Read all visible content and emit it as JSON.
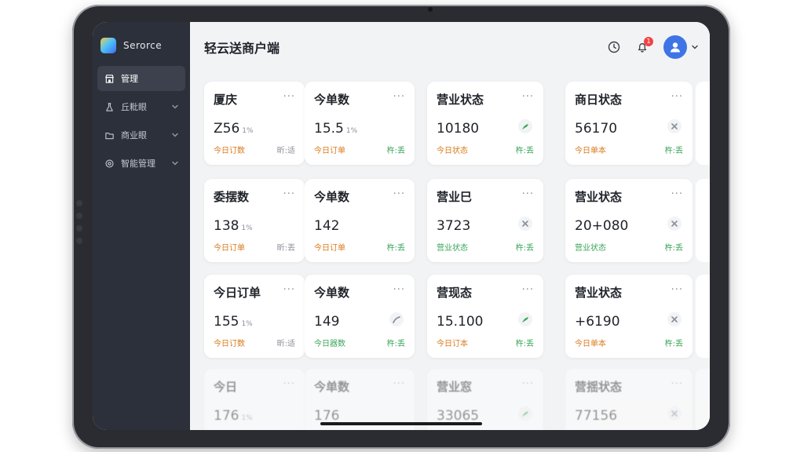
{
  "brand": {
    "name": "Serorce"
  },
  "sidebar": {
    "items": [
      {
        "label": "管理",
        "icon": "store-icon",
        "active": true,
        "chevron": false
      },
      {
        "label": "丘粃眼",
        "icon": "flask-icon",
        "active": false,
        "chevron": true
      },
      {
        "label": "商业眼",
        "icon": "folder-icon",
        "active": false,
        "chevron": true
      },
      {
        "label": "智能管理",
        "icon": "settings-icon",
        "active": false,
        "chevron": true
      }
    ]
  },
  "header": {
    "title": "轻云送商户端",
    "notification_count": "1"
  },
  "colors": {
    "accent": "#3f74e6",
    "sidebar": "#2c303a",
    "orange": "#d97a1a",
    "green": "#3aa55a"
  },
  "cards": [
    {
      "title": "厦庆",
      "value": "Z56",
      "unit": "1%",
      "foot_left": "今日订数",
      "foot_right": "昕:适",
      "trend": "none"
    },
    {
      "title": "今单数",
      "value": "15.5",
      "unit": "1%",
      "foot_left": "今日订单",
      "foot_right": "杵:丢",
      "trend": "none"
    },
    {
      "title": "营业状态",
      "value": "10180",
      "unit": "",
      "foot_left": "今日状态",
      "foot_right": "杵:丢",
      "trend": "up-green"
    },
    {
      "title": "商日状态",
      "value": "56170",
      "unit": "",
      "foot_left": "今日单本",
      "foot_right": "杵:丢",
      "trend": "cross"
    },
    {
      "title": "委摆数",
      "value": "138",
      "unit": "1%",
      "foot_left": "今日订单",
      "foot_right": "昕:丟",
      "trend": "none"
    },
    {
      "title": "今单数",
      "value": "142",
      "unit": "",
      "foot_left": "今日订单",
      "foot_right": "杵:丢",
      "trend": "none"
    },
    {
      "title": "营业巳",
      "value": "3723",
      "unit": "",
      "foot_left": "营业状态",
      "foot_right": "杵:丢",
      "trend": "cross"
    },
    {
      "title": "营业状态",
      "value": "20+080",
      "unit": "",
      "foot_left": "营业状态",
      "foot_right": "杵:丢",
      "trend": "cross"
    },
    {
      "title": "今日订单",
      "value": "155",
      "unit": "1%",
      "foot_left": "今日订数",
      "foot_right": "昕:适",
      "trend": "none"
    },
    {
      "title": "今单数",
      "value": "149",
      "unit": "",
      "foot_left": "今日器数",
      "foot_right": "杵:丢",
      "trend": "up-gray"
    },
    {
      "title": "营现态",
      "value": "15.100",
      "unit": "",
      "foot_left": "今日订本",
      "foot_right": "杵:丢",
      "trend": "up-green"
    },
    {
      "title": "营业状态",
      "value": "+6190",
      "unit": "",
      "foot_left": "今日单本",
      "foot_right": "杵:丢",
      "trend": "cross"
    },
    {
      "title": "今日",
      "value": "176",
      "unit": "1%",
      "foot_left": "",
      "foot_right": "",
      "trend": "none",
      "faded": true
    },
    {
      "title": "今单数",
      "value": "176",
      "unit": "",
      "foot_left": "",
      "foot_right": "",
      "trend": "none",
      "faded": true
    },
    {
      "title": "营业窓",
      "value": "33065",
      "unit": "",
      "foot_left": "",
      "foot_right": "",
      "trend": "up-green",
      "faded": true
    },
    {
      "title": "营揺状态",
      "value": "77156",
      "unit": "",
      "foot_left": "",
      "foot_right": "",
      "trend": "cross",
      "faded": true
    }
  ]
}
